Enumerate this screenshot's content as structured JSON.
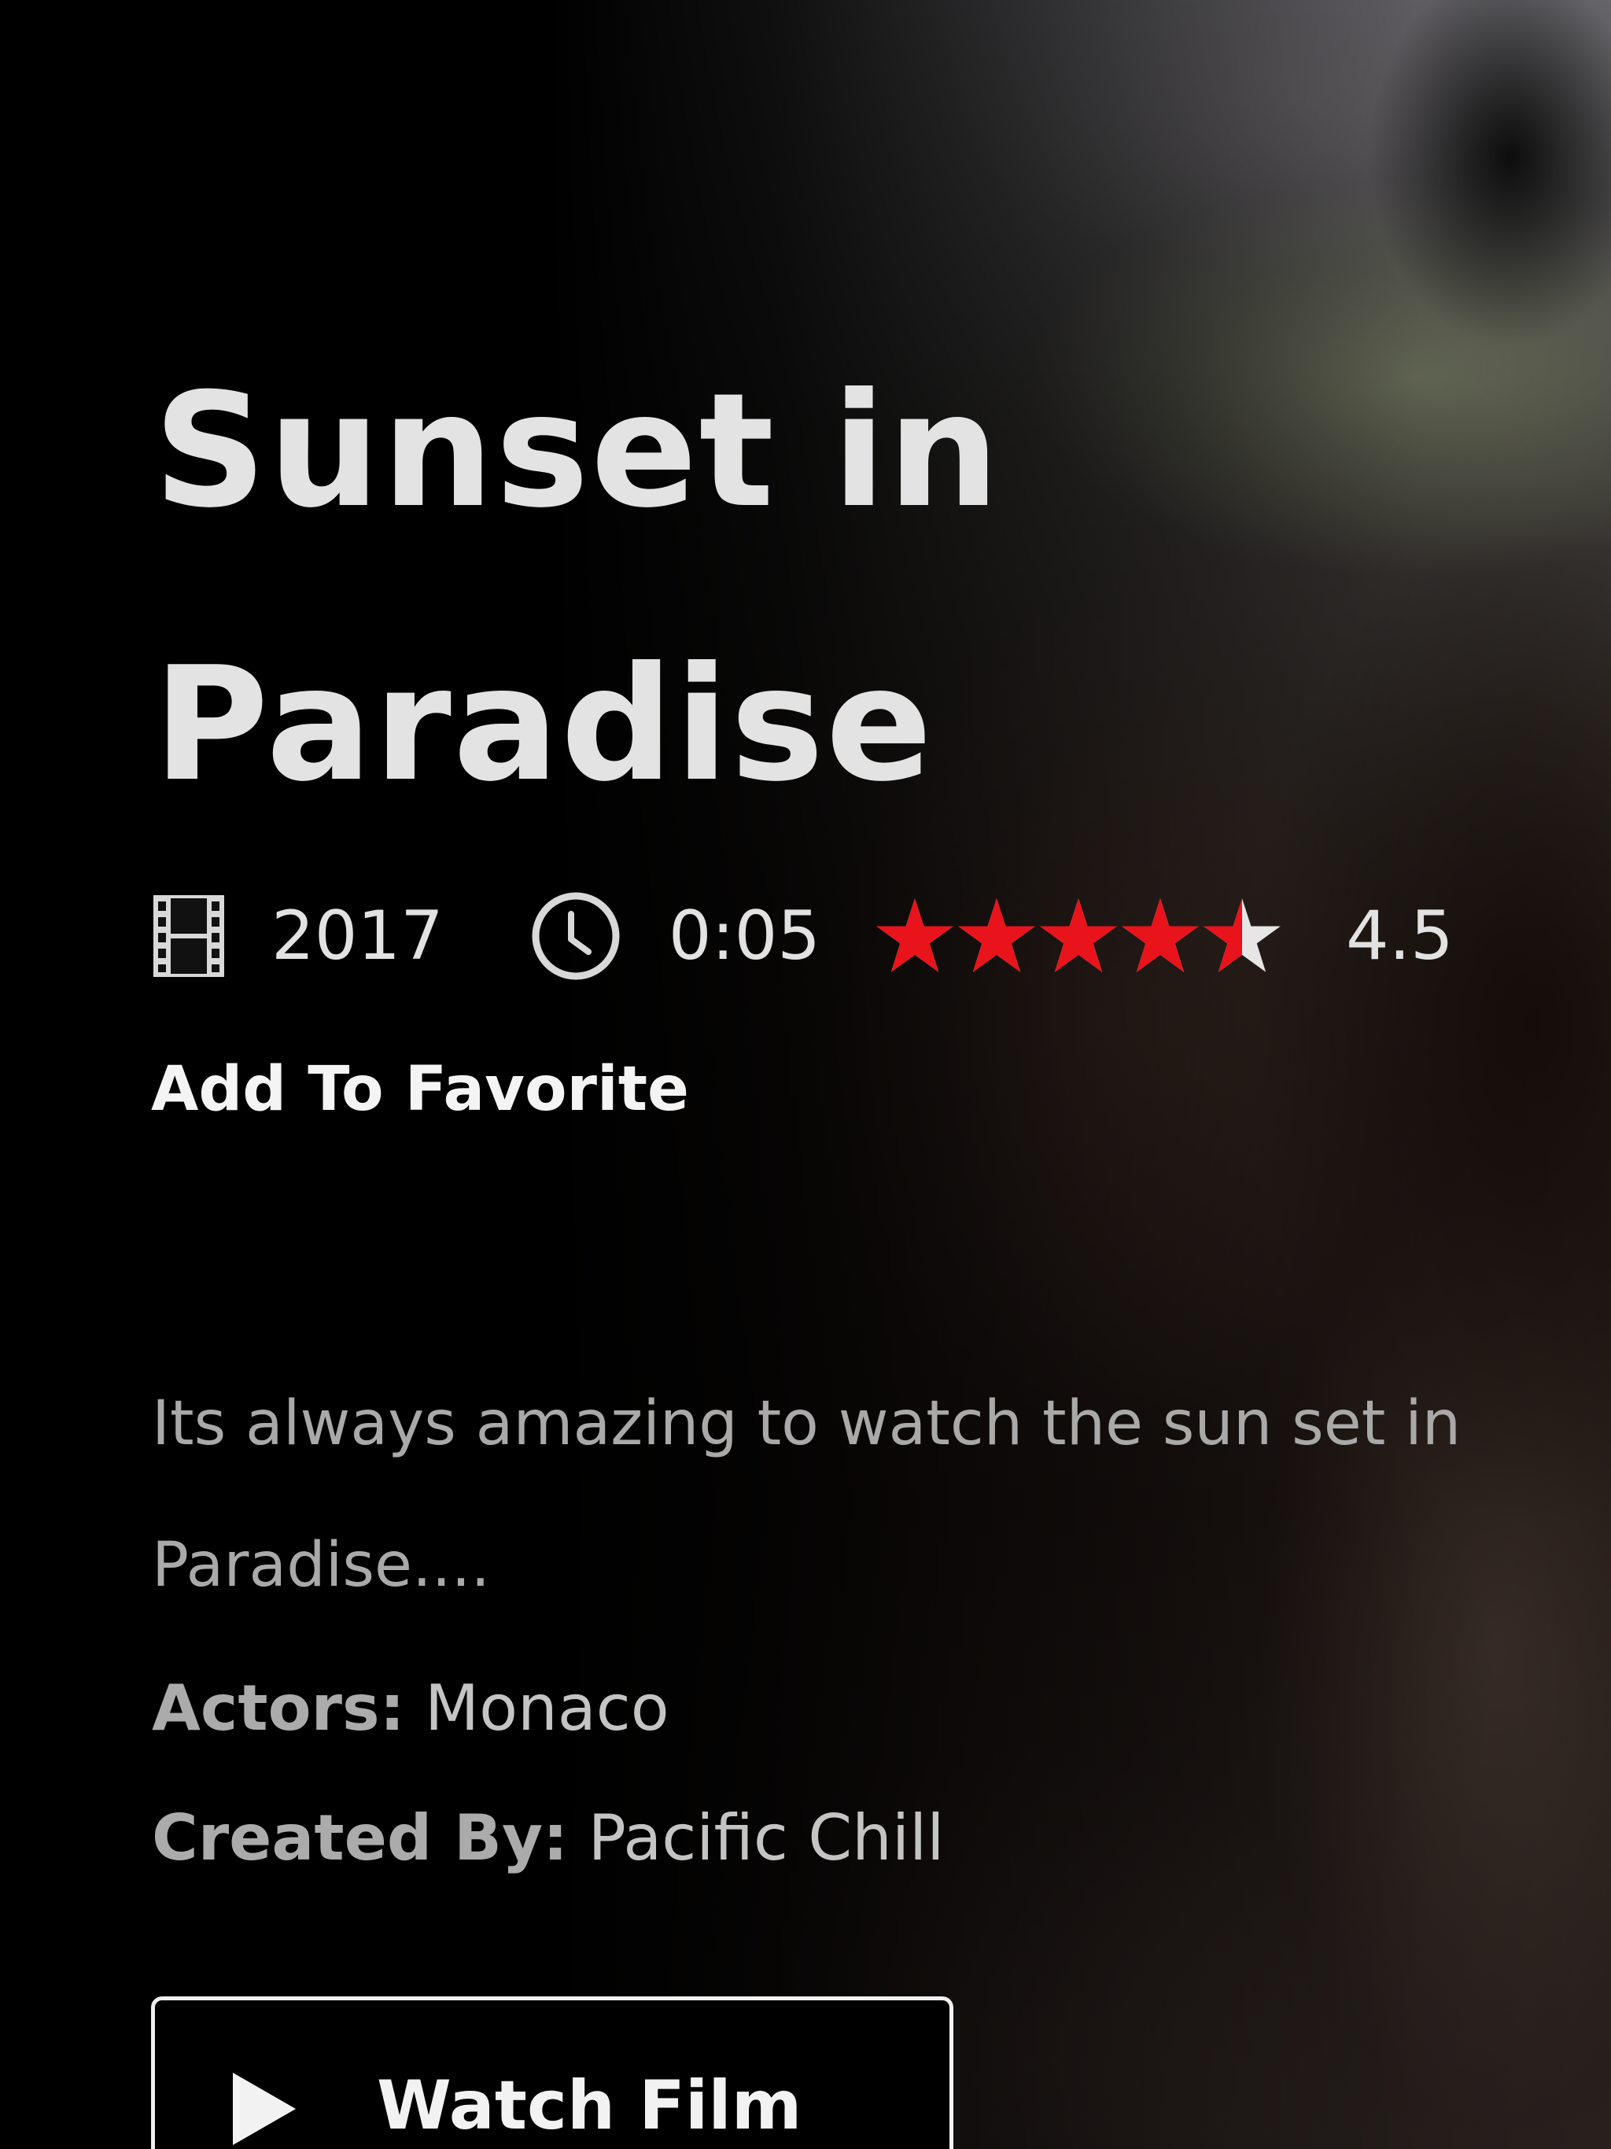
{
  "movie": {
    "title": "Sunset in Paradise",
    "year": "2017",
    "duration": "0:05",
    "rating": 4.5,
    "rating_max": 5,
    "rating_label": "4.5",
    "favorite_label": "Add To Favorite",
    "description": "Its always amazing to watch the sun set in Paradise....",
    "actors_label": "Actors:",
    "actors_value": "Monaco",
    "created_label": "Created By:",
    "created_value": "Pacific Chill",
    "watch_label": "Watch Film"
  },
  "icons": {
    "year": "film-strip-icon",
    "duration": "clock-icon",
    "watch": "play-icon"
  },
  "colors": {
    "star_filled": "#e8131b",
    "star_empty": "#e6e6e6",
    "title": "#e3e3e3"
  }
}
